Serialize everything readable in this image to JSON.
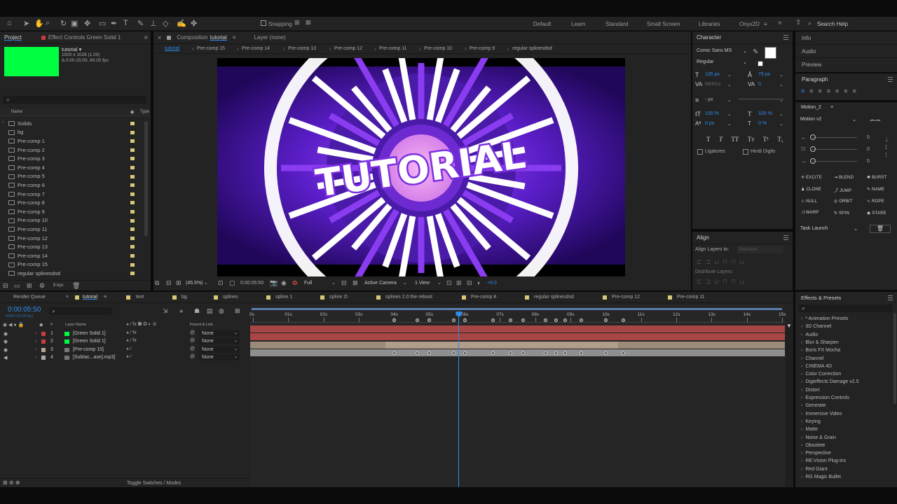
{
  "toolbar": {
    "snapping": "Snapping",
    "workspaces": [
      "Default",
      "Learn",
      "Standard",
      "Small Screen",
      "Libraries",
      "Onyx2D"
    ],
    "search_help": "Search Help"
  },
  "project": {
    "tab_project": "Project",
    "tab_effect_controls": "Effect Controls Green Solid 1",
    "comp_name": "tutorial ▾",
    "comp_info_1": "1920 x 1028 (1.00)",
    "comp_info_2": "Δ 0:00:15:00, 60.00 fps",
    "col_name": "Name",
    "col_type": "Type",
    "items": [
      "Solids",
      "bg",
      "Pre-comp 1",
      "Pre-comp 2",
      "Pre-comp 3",
      "Pre-comp 4",
      "Pre-comp 5",
      "Pre-comp 6",
      "Pre-comp 7",
      "Pre-comp 8",
      "Pre-comp 9",
      "Pre-comp 10",
      "Pre-comp 11",
      "Pre-comp 12",
      "Pre-comp 13",
      "Pre-comp 14",
      "Pre-comp 15",
      "regular splinesdsd"
    ],
    "bpc": "8 bpc"
  },
  "composition": {
    "tab_label": "Composition",
    "tab_comp_name": "tutorial",
    "layer_tab": "Layer (none)",
    "breadcrumbs": [
      "tutorial",
      "Pre-comp 15",
      "Pre-comp 14",
      "Pre-comp 13",
      "Pre-comp 12",
      "Pre-comp 11",
      "Pre-comp 10",
      "Pre-comp 9",
      "regular splinesdsd"
    ],
    "preview_title": "TUTORIAL",
    "zoom": "(45.5%)",
    "timecode": "0:00:05:50",
    "resolution": "Full",
    "camera": "Active Camera",
    "view": "1 View",
    "exposure": "+0.0"
  },
  "character": {
    "title": "Character",
    "font": "Comic Sans MS",
    "style": "Regular",
    "size": "135 px",
    "leading": "79 px",
    "kerning": "Metrics",
    "tracking": "0",
    "stroke": "- px",
    "vscale": "100 %",
    "hscale": "100 %",
    "baseline": "0 px",
    "tsume": "0 %",
    "styles": [
      "T",
      "T",
      "TT",
      "Tт",
      "T¹",
      "T₁"
    ],
    "ligatures": "Ligatures",
    "hindi_digits": "Hindi Digits"
  },
  "align": {
    "title": "Align",
    "align_layers_to": "Align Layers to:",
    "selection": "Selection",
    "distribute": "Distribute Layers:"
  },
  "right_panels": {
    "info": "Info",
    "audio": "Audio",
    "preview": "Preview",
    "paragraph": "Paragraph"
  },
  "motion": {
    "title": "Motion_2",
    "version": "Motion v2",
    "slider_values": [
      "0",
      "0",
      "0"
    ],
    "buttons": [
      "EXCITE",
      "BLEND",
      "BURST",
      "CLONE",
      "JUMP",
      "NAME",
      "NULL",
      "ORBIT",
      "ROPE",
      "WARP",
      "SPIN",
      "STARE"
    ],
    "task": "Task Launch"
  },
  "timeline": {
    "tabs": [
      "Render Queue",
      "tutorial",
      "text",
      "bg",
      "splines",
      "spline 1",
      "spline 2\\",
      "splines 2.0 the reboot",
      "Pre-comp 8",
      "regular splinesdsd",
      "Pre-comp 12",
      "Pre-comp 11"
    ],
    "timecode": "0:00:05:50",
    "frames": "00350 (60.00 fps)",
    "col_hash": "#",
    "col_layer_name": "Layer Name",
    "col_parent": "Parent & Link",
    "ruler": [
      "0s",
      "01s",
      "02s",
      "03s",
      "04s",
      "05s",
      "06s",
      "07s",
      "08s",
      "09s",
      "10s",
      "11s",
      "12s",
      "13s",
      "14s",
      "15s"
    ],
    "playhead_seconds": 5.83,
    "layers": [
      {
        "num": "1",
        "name": "[Green Solid 1]",
        "parent": "None",
        "color": "#c83c3c"
      },
      {
        "num": "2",
        "name": "[Green Solid 1]",
        "parent": "None",
        "color": "#c83c3c"
      },
      {
        "num": "3",
        "name": "[Pre-comp 15]",
        "parent": "None",
        "color": "#b4a890"
      },
      {
        "num": "4",
        "name": "[Subtac...ase].mp3]",
        "parent": "None",
        "color": "#a9a9a9"
      }
    ],
    "keyframes_seconds": [
      4.0,
      4.65,
      5.0,
      5.7,
      6.0,
      6.8,
      7.3,
      7.65,
      8.3,
      8.6,
      8.85,
      9.3,
      10.0,
      10.5
    ],
    "toggle": "Toggle Switches / Modes"
  },
  "effects": {
    "title": "Effects & Presets",
    "items": [
      "* Animation Presets",
      "3D Channel",
      "Audio",
      "Blur & Sharpen",
      "Boris FX Mocha",
      "Channel",
      "CINEMA 4D",
      "Color Correction",
      "Digieffects Damage v2.5",
      "Distort",
      "Expression Controls",
      "Generate",
      "Immersive Video",
      "Keying",
      "Matte",
      "Noise & Grain",
      "Obsolete",
      "Perspective",
      "RE:Vision Plug-ins",
      "Red Giant",
      "RG Magic Bullet"
    ]
  },
  "colors": {
    "accent": "#2d8ceb",
    "green_solid": "#00ff40",
    "layer_red": "#a74645",
    "timecode": "#2d8ceb"
  }
}
